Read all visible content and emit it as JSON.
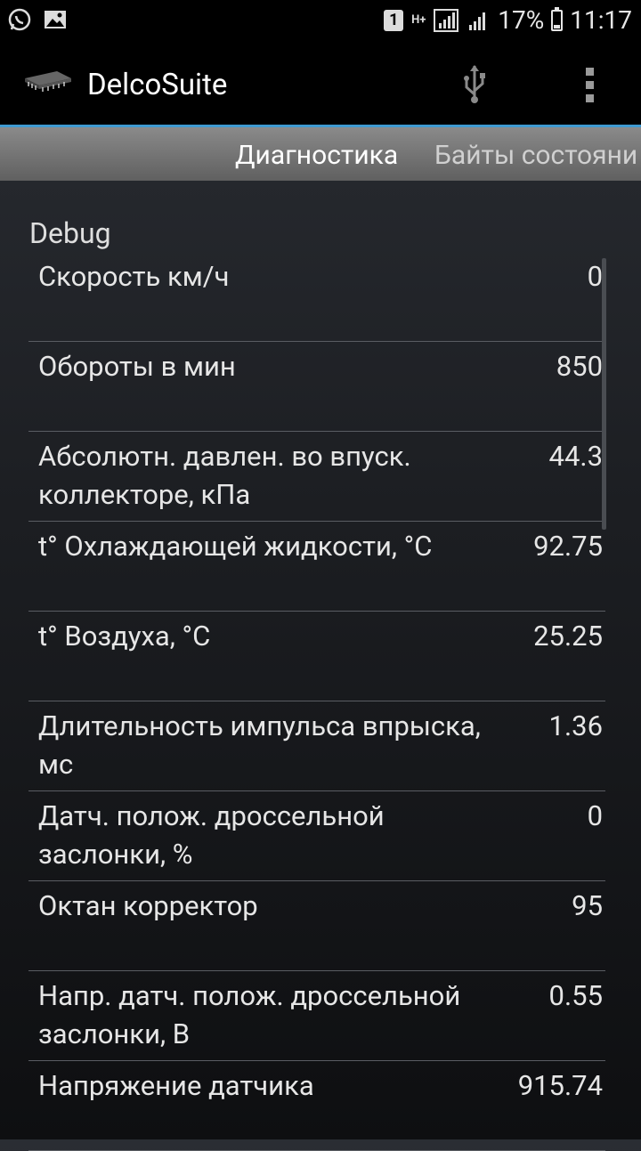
{
  "status_bar": {
    "sim_badge": "1",
    "network_type": "H+",
    "battery_percent": "17%",
    "time": "11:17"
  },
  "action_bar": {
    "app_title": "DelcoSuite"
  },
  "tabs": [
    {
      "label": "Диагностика",
      "active": true
    },
    {
      "label": "Байты состояни",
      "active": false
    }
  ],
  "section": {
    "title": "Debug"
  },
  "params": [
    {
      "label": "Скорость км/ч",
      "value": "0"
    },
    {
      "label": "Обороты в мин",
      "value": "850"
    },
    {
      "label": "Абсолютн. давлен. во впуск. коллекторе, кПа",
      "value": "44.3"
    },
    {
      "label": "t° Охлаждающей жидкости, °C",
      "value": "92.75"
    },
    {
      "label": "t° Воздуха, °C",
      "value": "25.25"
    },
    {
      "label": "Длительность импульса впрыска, мс",
      "value": "1.36"
    },
    {
      "label": "Датч. полож. дроссельной заслонки, %",
      "value": "0"
    },
    {
      "label": "Октан корректор",
      "value": "95"
    },
    {
      "label": "Напр. датч. полож. дроссельной заслонки, В",
      "value": "0.55"
    },
    {
      "label": "Напряжение датчика",
      "value": "915.74"
    }
  ]
}
